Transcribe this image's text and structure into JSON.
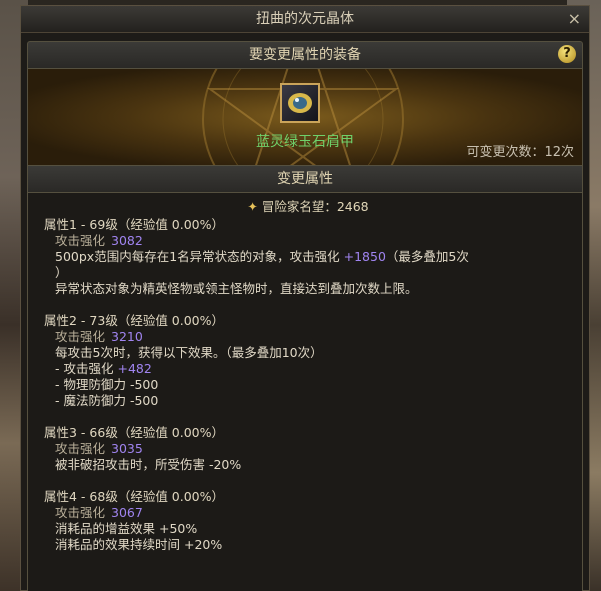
{
  "window": {
    "title": "扭曲的次元晶体",
    "close_label": "×"
  },
  "equip_section": {
    "header": "要变更属性的装备",
    "help_label": "?",
    "item_name": "蓝灵绿玉石肩甲",
    "change_count": "可变更次数：12次"
  },
  "attr_section": {
    "header": "变更属性",
    "reputation": "冒险家名望：2468",
    "attributes": [
      {
        "title": "属性1 - 69级（经验值 0.00%）",
        "atk_label": "攻击强化",
        "atk_value": "3082",
        "lines": [
          {
            "a": "500px范围内每存在1名异常状态的对象，攻击强化 ",
            "b": "+1850",
            "c": "（最多叠加5次"
          },
          {
            "a": "）",
            "b": "",
            "c": ""
          },
          {
            "a": "异常状态对象为精英怪物或领主怪物时，直接达到叠加次数上限。",
            "b": "",
            "c": ""
          }
        ]
      },
      {
        "title": "属性2 - 73级（经验值 0.00%）",
        "atk_label": "攻击强化",
        "atk_value": "3210",
        "lines": [
          {
            "a": "每攻击5次时，获得以下效果。（最多叠加10次）",
            "b": "",
            "c": ""
          },
          {
            "a": "- 攻击强化 ",
            "b": "+482",
            "c": ""
          },
          {
            "a": "- 物理防御力 -500",
            "b": "",
            "c": ""
          },
          {
            "a": "- 魔法防御力 -500",
            "b": "",
            "c": ""
          }
        ]
      },
      {
        "title": "属性3 - 66级（经验值 0.00%）",
        "atk_label": "攻击强化",
        "atk_value": "3035",
        "lines": [
          {
            "a": "被非破招攻击时，所受伤害 -20%",
            "b": "",
            "c": ""
          }
        ]
      },
      {
        "title": "属性4 - 68级（经验值 0.00%）",
        "atk_label": "攻击强化",
        "atk_value": "3067",
        "lines": [
          {
            "a": "消耗品的增益效果 +50%",
            "b": "",
            "c": ""
          },
          {
            "a": "消耗品的效果持续时间 +20%",
            "b": "",
            "c": ""
          }
        ]
      }
    ]
  },
  "colors": {
    "item_name": "#6fd06a",
    "bonus": "#a084f0",
    "gold": "#caa45a"
  },
  "icons": [
    "close-icon",
    "help-icon",
    "shoulder-armor-icon",
    "reputation-icon"
  ]
}
